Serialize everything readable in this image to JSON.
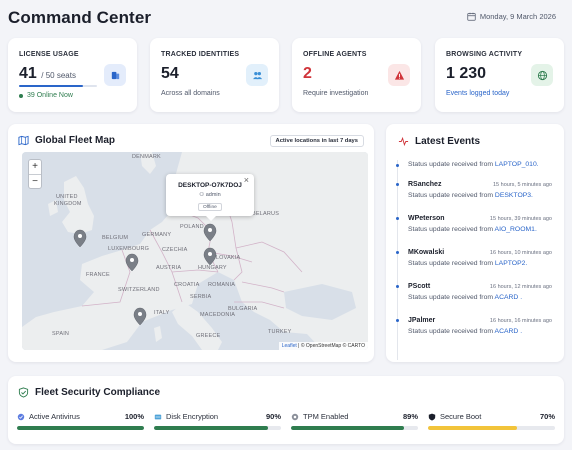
{
  "header": {
    "title": "Command Center",
    "date": "Monday, 9 March 2026"
  },
  "kpis": {
    "license": {
      "label": "LICENSE USAGE",
      "value": "41",
      "value_suffix": "/ 50 seats",
      "sub": "39 Online Now",
      "usage_fraction": 0.82,
      "icon": "seats-icon"
    },
    "identities": {
      "label": "TRACKED IDENTITIES",
      "value": "54",
      "sub": "Across all domains",
      "icon": "users-icon"
    },
    "offline": {
      "label": "OFFLINE AGENTS",
      "value": "2",
      "sub": "Require investigation",
      "icon": "warning-icon"
    },
    "browsing": {
      "label": "BROWSING ACTIVITY",
      "value": "1 230",
      "sub": "Events logged today",
      "icon": "globe-icon"
    }
  },
  "map": {
    "title": "Global Fleet Map",
    "badge": "Active locations in last 7 days",
    "zoom_in": "+",
    "zoom_out": "−",
    "popup": {
      "host": "DESKTOP-O7K7DOJ",
      "user": "admin",
      "status": "Offline",
      "close": "×"
    },
    "attribution": {
      "leaflet": "Leaflet",
      "rest": "| © OpenStreetMap © CARTO"
    },
    "labels": {
      "denmark": "DENMARK",
      "uk": "UNITED\nKINGDOM",
      "belarus": "BELARUS",
      "poland": "POLAND",
      "belgium": "BELGIUM",
      "germany": "GERMANY",
      "luxembourg": "LUXEMBOURG",
      "czechia": "CZECHIA",
      "slovakia": "SLOVAKIA",
      "austria": "AUSTRIA",
      "france": "FRANCE",
      "hungary": "HUNGARY",
      "romania": "ROMANIA",
      "switzerland": "SWITZERLAND",
      "croatia": "CROATIA",
      "serbia": "SERBIA",
      "italy": "ITALY",
      "bulgaria": "BULGARIA",
      "macedonia": "MACEDONIA",
      "spain": "SPAIN",
      "greece": "GREECE",
      "turkey": "TURKEY"
    }
  },
  "events": {
    "title": "Latest Events",
    "items": [
      {
        "user": "",
        "time": "",
        "text": "Status update received from",
        "device": "LAPTOP_010."
      },
      {
        "user": "RSanchez",
        "time": "15 hours, 5 minutes ago",
        "text": "Status update received from",
        "device": "DESKTOP3."
      },
      {
        "user": "WPeterson",
        "time": "15 hours, 39 minutes ago",
        "text": "Status update received from",
        "device": "AIO_ROOM1."
      },
      {
        "user": "MKowalski",
        "time": "16 hours, 10 minutes ago",
        "text": "Status update received from",
        "device": "LAPTOP2."
      },
      {
        "user": "PScott",
        "time": "16 hours, 12 minutes ago",
        "text": "Status update received from",
        "device": "ACARD ."
      },
      {
        "user": "JPalmer",
        "time": "16 hours, 16 minutes ago",
        "text": "Status update received from",
        "device": "ACARD ."
      }
    ]
  },
  "compliance": {
    "title": "Fleet Security Compliance",
    "items": [
      {
        "label": "Active Antivirus",
        "percent": "100%",
        "value": 100,
        "color": "#2f7d4f",
        "icon": "antivirus-icon"
      },
      {
        "label": "Disk Encryption",
        "percent": "90%",
        "value": 90,
        "color": "#2f7d4f",
        "icon": "disk-icon"
      },
      {
        "label": "TPM Enabled",
        "percent": "89%",
        "value": 89,
        "color": "#2f7d4f",
        "icon": "chip-icon"
      },
      {
        "label": "Secure Boot",
        "percent": "70%",
        "value": 70,
        "color": "#f2c43a",
        "icon": "shield-icon"
      }
    ]
  },
  "colors": {
    "accent_blue": "#2a65c9",
    "success_green": "#2f7d4f",
    "danger_red": "#d0343a",
    "warning_yellow": "#f2c43a"
  }
}
